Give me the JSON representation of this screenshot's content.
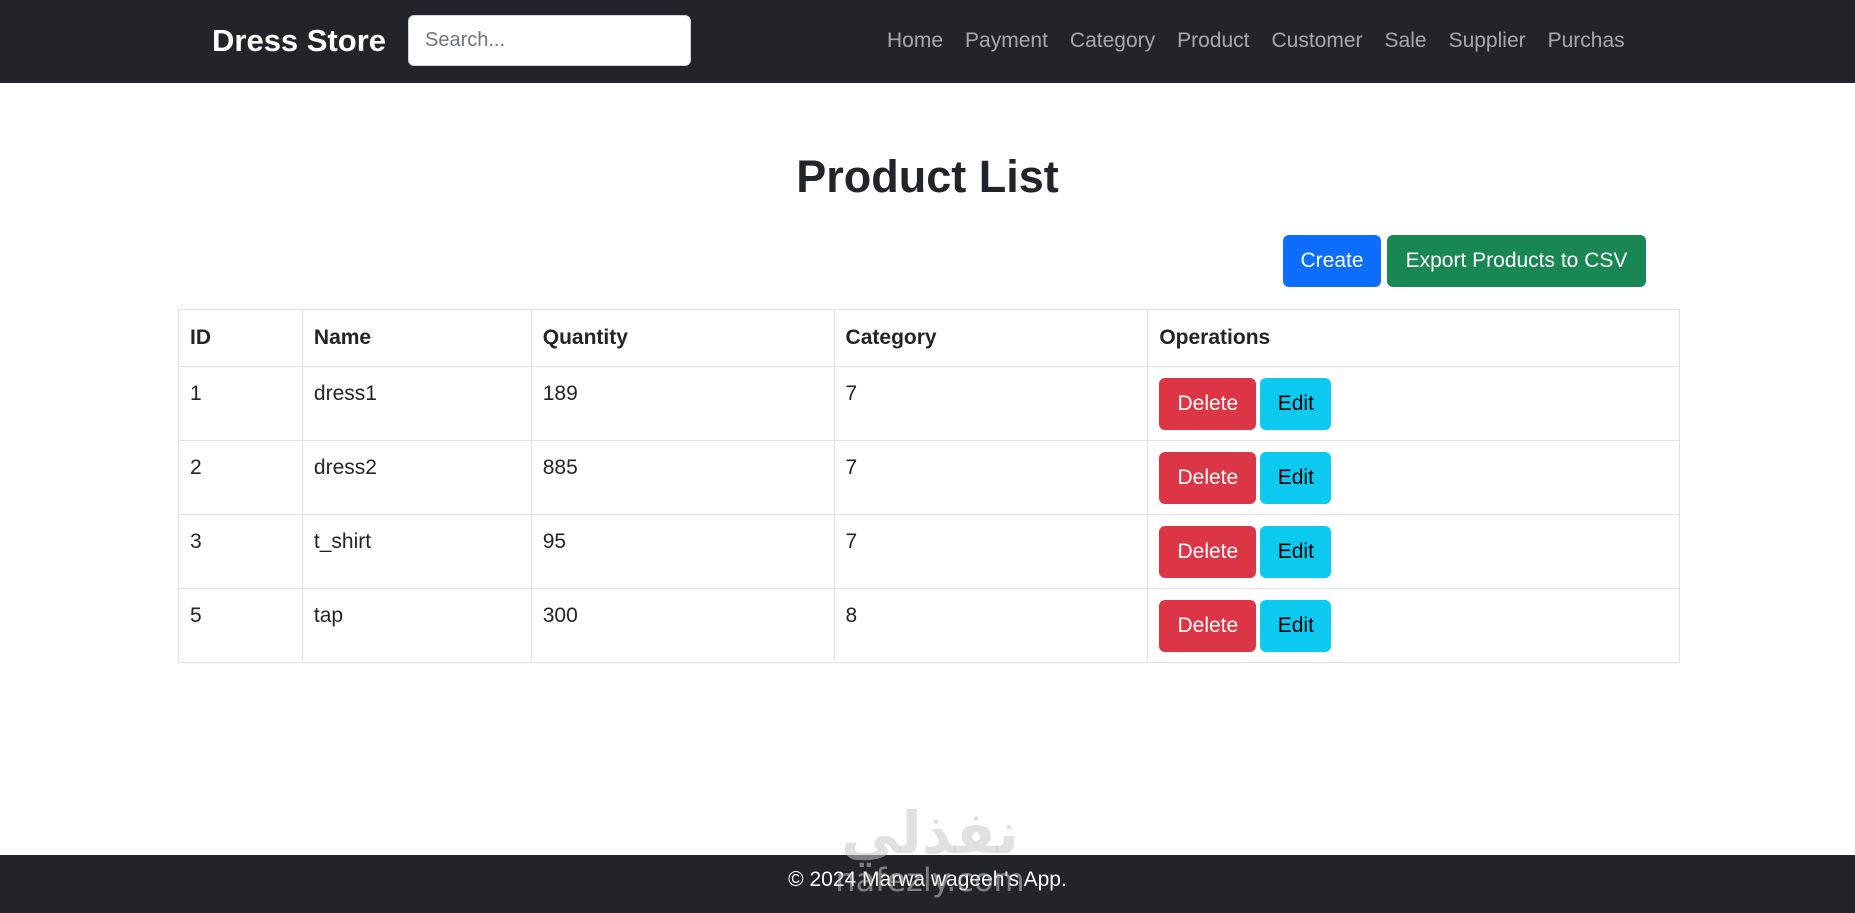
{
  "navbar": {
    "brand": "Dress Store",
    "search_placeholder": "Search...",
    "items": [
      {
        "label": "Home"
      },
      {
        "label": "Payment"
      },
      {
        "label": "Category"
      },
      {
        "label": "Product"
      },
      {
        "label": "Customer"
      },
      {
        "label": "Sale"
      },
      {
        "label": "Supplier"
      },
      {
        "label": "Purchas"
      }
    ]
  },
  "main": {
    "title": "Product List",
    "create_label": "Create",
    "export_label": "Export Products to CSV"
  },
  "table": {
    "headers": [
      "ID",
      "Name",
      "Quantity",
      "Category",
      "Operations"
    ],
    "delete_label": "Delete",
    "edit_label": "Edit",
    "rows": [
      {
        "id": "1",
        "name": "dress1",
        "quantity": "189",
        "category": "7"
      },
      {
        "id": "2",
        "name": "dress2",
        "quantity": "885",
        "category": "7"
      },
      {
        "id": "3",
        "name": "t_shirt",
        "quantity": "95",
        "category": "7"
      },
      {
        "id": "5",
        "name": "tap",
        "quantity": "300",
        "category": "8"
      }
    ]
  },
  "footer": {
    "text": "© 2024 Marwa wageeh's App."
  },
  "watermark": {
    "arabic": "نفذلي",
    "latin": "nafezly.com"
  },
  "colors": {
    "navbar_bg": "#212529",
    "primary": "#0d6efd",
    "success": "#198754",
    "danger": "#dc3545",
    "info": "#0dcaf0"
  }
}
